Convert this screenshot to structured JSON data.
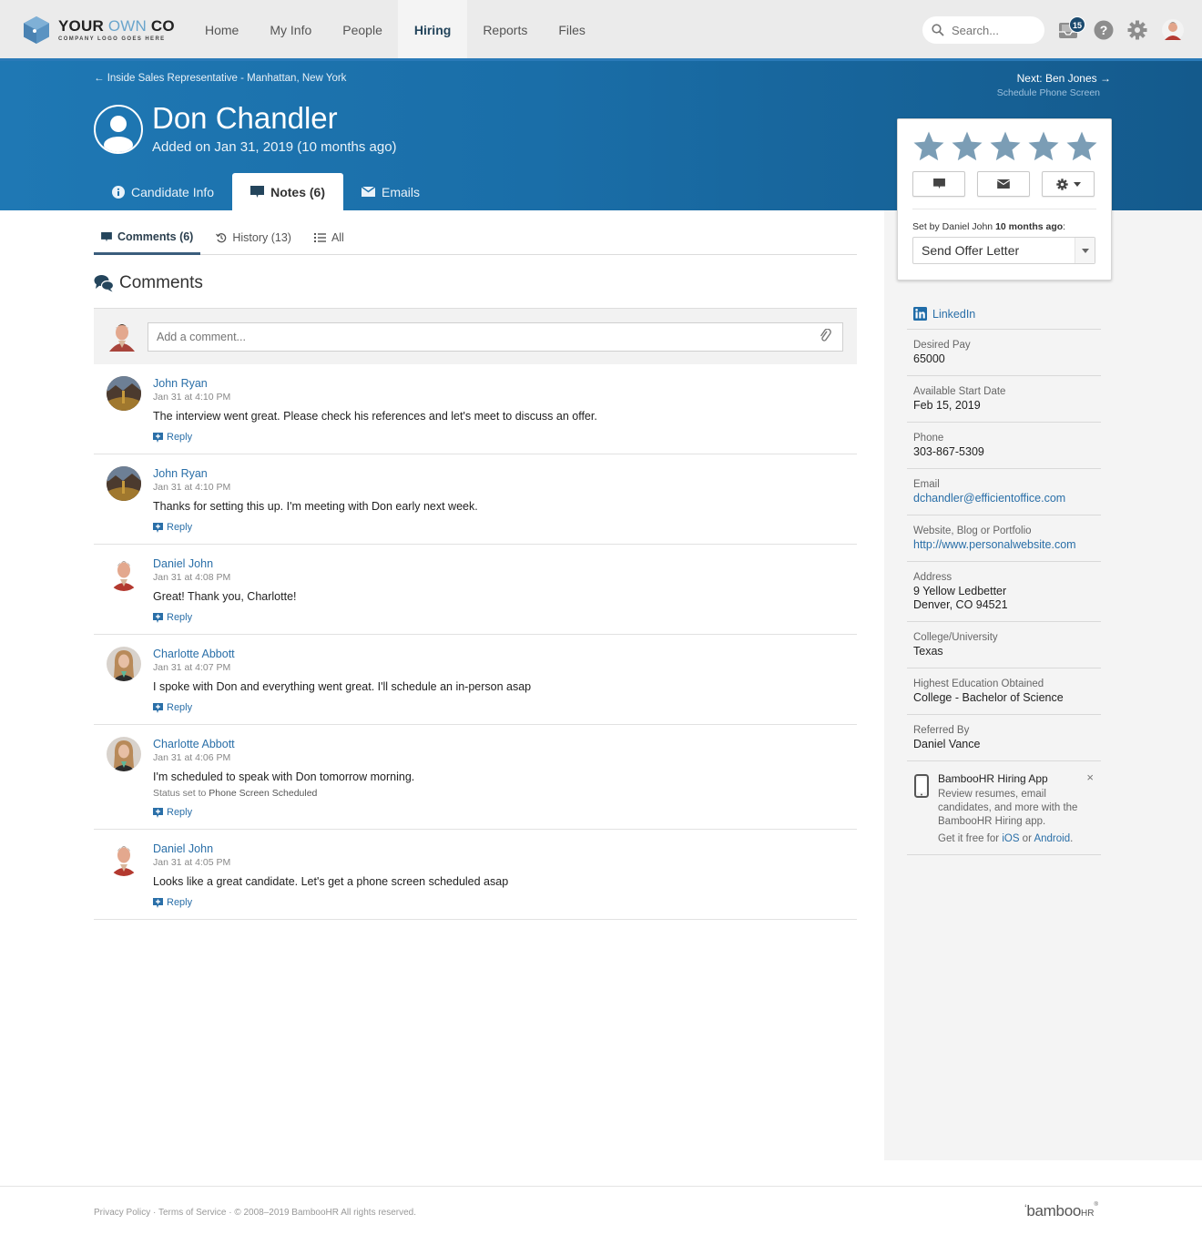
{
  "logo": {
    "main_a": "YOUR ",
    "main_b": "OWN",
    "main_c": " CO",
    "sub": "COMPANY LOGO GOES HERE"
  },
  "nav": {
    "items": [
      {
        "label": "Home",
        "active": false
      },
      {
        "label": "My Info",
        "active": false
      },
      {
        "label": "People",
        "active": false
      },
      {
        "label": "Hiring",
        "active": true
      },
      {
        "label": "Reports",
        "active": false
      },
      {
        "label": "Files",
        "active": false
      }
    ],
    "search_placeholder": "Search...",
    "inbox_count": "15",
    "icons": [
      "inbox-icon",
      "help-icon",
      "gear-icon",
      "user-avatar"
    ]
  },
  "hero": {
    "breadcrumb": "← Inside Sales Representative - Manhattan, New York",
    "next_label": "Next: Ben Jones →",
    "next_status": "Schedule Phone Screen",
    "candidate_name": "Don Chandler",
    "added": "Added on Jan 31, 2019 (10 months ago)",
    "tabs": [
      {
        "label": "Candidate Info",
        "icon": "info-icon",
        "active": false
      },
      {
        "label": "Notes (6)",
        "icon": "comment-icon",
        "active": true
      },
      {
        "label": "Emails",
        "icon": "envelope-icon",
        "active": false
      }
    ]
  },
  "rating_card": {
    "rating": 0,
    "max_rating": 5,
    "action_buttons": [
      "comment-icon",
      "envelope-icon",
      "gear-dropdown-icon"
    ],
    "set_by_prefix": "Set by Daniel John ",
    "set_by_when": "10 months ago",
    "set_by_suffix": ":",
    "status_value": "Send Offer Letter"
  },
  "subtabs": [
    {
      "label": "Comments (6)",
      "icon": "comment-icon",
      "active": true
    },
    {
      "label": "History (13)",
      "icon": "history-icon",
      "active": false
    },
    {
      "label": "All",
      "icon": "list-icon",
      "active": false
    }
  ],
  "comments_section": {
    "title": "Comments",
    "input_placeholder": "Add a comment...",
    "reply_label": "Reply",
    "items": [
      {
        "author": "John Ryan",
        "time": "Jan 31 at 4:10 PM",
        "text": "The interview went great. Please check his references and let's meet to discuss an offer.",
        "avatar": "landscape"
      },
      {
        "author": "John Ryan",
        "time": "Jan 31 at 4:10 PM",
        "text": "Thanks for setting this up. I'm meeting with Don early next week.",
        "avatar": "landscape"
      },
      {
        "author": "Daniel John",
        "time": "Jan 31 at 4:08 PM",
        "text": "Great! Thank you, Charlotte!",
        "avatar": "man"
      },
      {
        "author": "Charlotte Abbott",
        "time": "Jan 31 at 4:07 PM",
        "text": "I spoke with Don and everything went great. I'll schedule an in-person asap",
        "avatar": "woman"
      },
      {
        "author": "Charlotte Abbott",
        "time": "Jan 31 at 4:06 PM",
        "text": "I'm scheduled to speak with Don tomorrow morning.",
        "status_prefix": "Status set to ",
        "status_value": "Phone Screen Scheduled",
        "avatar": "woman"
      },
      {
        "author": "Daniel John",
        "time": "Jan 31 at 4:05 PM",
        "text": "Looks like a great candidate. Let's get a phone screen scheduled asap",
        "avatar": "man"
      }
    ]
  },
  "candidate_info": {
    "linkedin_label": "LinkedIn",
    "fields": [
      {
        "label": "Desired Pay",
        "value": "65000",
        "link": false
      },
      {
        "label": "Available Start Date",
        "value": "Feb 15, 2019",
        "link": false
      },
      {
        "label": "Phone",
        "value": "303-867-5309",
        "link": false
      },
      {
        "label": "Email",
        "value": "dchandler@efficientoffice.com",
        "link": true
      },
      {
        "label": "Website, Blog or Portfolio",
        "value": "http://www.personalwebsite.com",
        "link": true
      },
      {
        "label": "Address",
        "value": "9 Yellow Ledbetter",
        "value2": "Denver, CO 94521",
        "link": false
      },
      {
        "label": "College/University",
        "value": "Texas",
        "link": false
      },
      {
        "label": "Highest Education Obtained",
        "value": "College - Bachelor of Science",
        "link": false
      },
      {
        "label": "Referred By",
        "value": "Daniel Vance",
        "link": false
      }
    ],
    "promo": {
      "title": "BambooHR Hiring App",
      "body": "Review resumes, email candidates, and more with the BambooHR Hiring app.",
      "get_prefix": "Get it free for ",
      "ios": "iOS",
      "or": " or ",
      "android": "Android",
      "suffix": ".",
      "close": "×"
    }
  },
  "footer": {
    "privacy": "Privacy Policy",
    "sep": " · ",
    "terms": "Terms of Service",
    "copyright": " · © 2008–2019 BambooHR All rights reserved.",
    "brand": "bamboo",
    "brand_hr": "HR",
    "brand_reg": "®"
  },
  "colors": {
    "brand_blue": "#1f78b4",
    "link": "#2a6fa8",
    "star": "#7b9db5",
    "badge": "#1b4a6e"
  }
}
